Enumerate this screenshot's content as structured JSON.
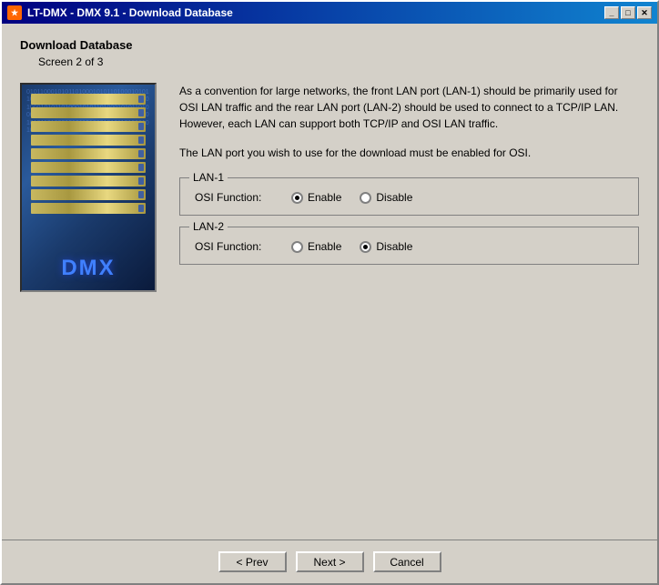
{
  "window": {
    "title": "LT-DMX - DMX 9.1 - Download Database",
    "icon": "★"
  },
  "title_controls": {
    "minimize": "_",
    "maximize": "□",
    "close": "✕"
  },
  "page": {
    "title": "Download Database",
    "subtitle": "Screen 2 of 3"
  },
  "description": {
    "paragraph1": "As a convention for large networks, the front LAN port (LAN-1) should be primarily used for OSI LAN traffic and the rear LAN port (LAN-2) should be used to connect to a TCP/IP LAN.  However, each LAN can support both TCP/IP and OSI LAN traffic.",
    "paragraph2": "The LAN port you wish to use for the download must be enabled for OSI."
  },
  "lan1": {
    "legend": "LAN-1",
    "label": "OSI Function:",
    "options": [
      "Enable",
      "Disable"
    ],
    "selected": "Enable"
  },
  "lan2": {
    "legend": "LAN-2",
    "label": "OSI Function:",
    "options": [
      "Enable",
      "Disable"
    ],
    "selected": "Disable"
  },
  "buttons": {
    "prev": "< Prev",
    "next": "Next >",
    "cancel": "Cancel"
  },
  "binary_text": "010110001010110100010101101000101011010001010110100010101101000101011010001010110100010101101000101011010001010110100010101101000101011010001010110100010101101000101011010001010110100010101101000"
}
